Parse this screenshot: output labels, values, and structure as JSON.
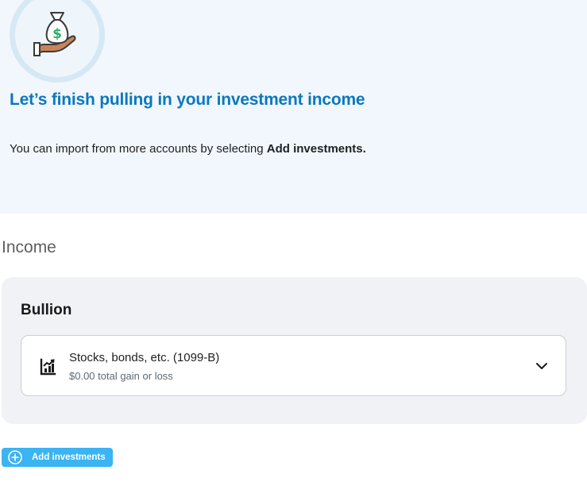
{
  "hero": {
    "icon": "money-bag-hand-icon",
    "title": "Let’s finish pulling in your investment income",
    "description_prefix": "You can import from more accounts by selecting ",
    "description_emphasis": "Add investments."
  },
  "income": {
    "heading": "Income",
    "card": {
      "title": "Bullion",
      "items": [
        {
          "icon": "chart-icon",
          "title": "Stocks, bonds, etc. (1099-B)",
          "subtitle": "$0.00 total gain or loss",
          "expand_icon": "chevron-down-icon"
        }
      ]
    }
  },
  "actions": {
    "add_investments_label": "Add investments",
    "add_icon": "plus-circle-icon"
  },
  "colors": {
    "accent": "#0a78be",
    "button": "#3ab4f2",
    "hero_background": "#f2f7fd",
    "card_background": "#f0f2f5"
  }
}
